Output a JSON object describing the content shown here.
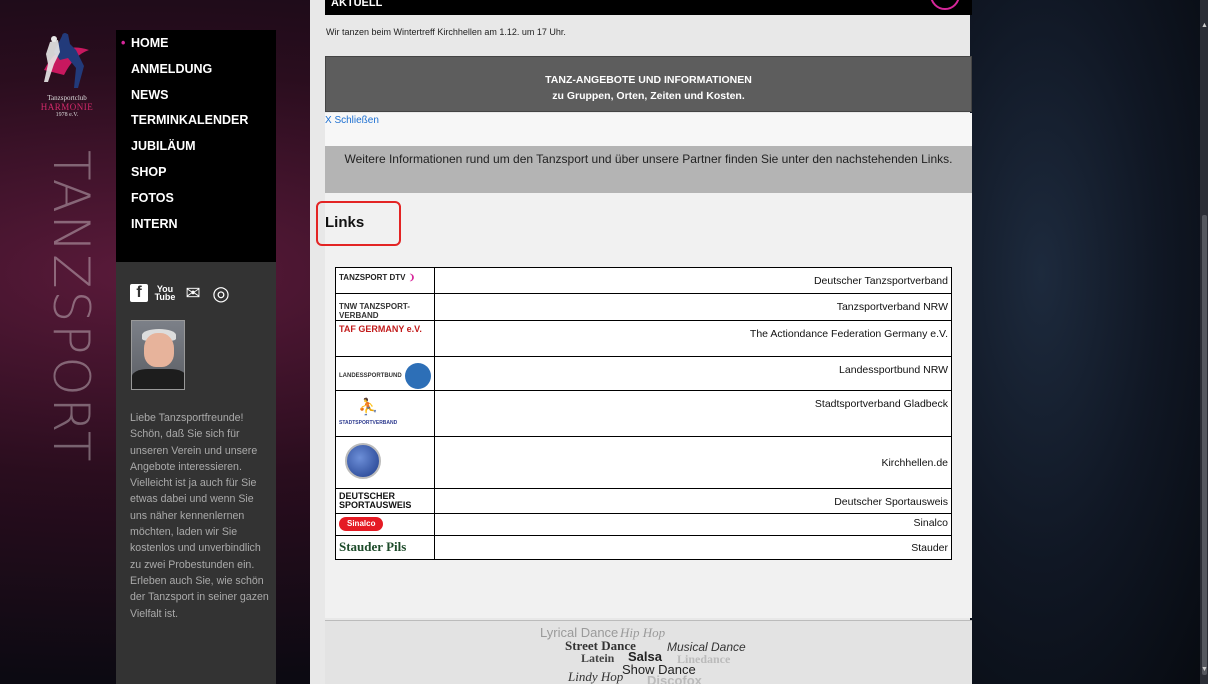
{
  "brand": {
    "logo_small": "Tanzsportclub",
    "logo_club": "HARMONIE",
    "logo_year": "1978 e.V.",
    "vertical_word": "TANZSPORT"
  },
  "nav": {
    "items": [
      {
        "label": "HOME",
        "active": true
      },
      {
        "label": "ANMELDUNG"
      },
      {
        "label": "NEWS"
      },
      {
        "label": "TERMINKALENDER"
      },
      {
        "label": "JUBILÄUM"
      },
      {
        "label": "SHOP"
      },
      {
        "label": "FOTOS"
      },
      {
        "label": "INTERN"
      }
    ]
  },
  "social": {
    "facebook": "f",
    "youtube_top": "You",
    "youtube_bottom": "Tube",
    "mail": "✉",
    "instagram": "◎"
  },
  "sidebar": {
    "welcome_text": "Liebe Tanzsportfreunde! Schön, daß Sie sich für unseren Verein und unsere Angebote interessieren. Vielleicht ist ja auch für Sie etwas dabei und wenn Sie uns näher kennenlernen möchten, laden wir Sie kostenlos und unverbindlich zu zwei Probestunden ein. Erleben auch Sie, wie schön der Tanzsport in seiner gazen Vielfalt ist."
  },
  "main": {
    "aktuell_label": "AKTUELL",
    "news_line": "Wir tanzen beim Wintertreff Kirchhellen am 1.12. um 17 Uhr.",
    "offers_title_1": "TANZ-ANGEBOTE UND INFORMATIONEN",
    "offers_title_2": "zu Gruppen, Orten, Zeiten und Kosten.",
    "close_link": "X Schließen",
    "info_text": "Weitere Informationen rund um den Tanzsport und über unsere Partner finden Sie unter den nachstehenden Links.",
    "links_title": "Links",
    "links": [
      {
        "name": "Deutscher Tanzsportverband",
        "logo": "TANZSPORT DTV"
      },
      {
        "name": "Tanzsportverband NRW",
        "logo": "TNW TANZSPORT-VERBAND"
      },
      {
        "name": "The Actiondance Federation Germany e.V.",
        "logo": "TAF GERMANY e.V."
      },
      {
        "name": "Landessportbund NRW",
        "logo": "LANDESSPORTBUND"
      },
      {
        "name": "Stadtsportverband Gladbeck",
        "logo": "STADTSPORTVERBAND"
      },
      {
        "name": "Kirchhellen.de",
        "logo": ""
      },
      {
        "name": "Deutscher Sportausweis",
        "logo": "DEUTSCHER SPORTAUSWEIS"
      },
      {
        "name": "Sinalco",
        "logo": "Sinalco"
      },
      {
        "name": "Stauder",
        "logo": "Stauder Pils"
      }
    ],
    "dance_cloud": [
      {
        "word": "Lyrical Dance",
        "style": "c1"
      },
      {
        "word": "Hip Hop",
        "style": "c2"
      },
      {
        "word": "Street Dance",
        "style": "c3"
      },
      {
        "word": "Musical Dance",
        "style": "c4"
      },
      {
        "word": "Latein",
        "style": "c5"
      },
      {
        "word": "Salsa",
        "style": "c6"
      },
      {
        "word": "Linedance",
        "style": "c7"
      },
      {
        "word": "Show Dance",
        "style": "c8"
      },
      {
        "word": "Lindy Hop",
        "style": "c9"
      },
      {
        "word": "Discofox",
        "style": "c10"
      }
    ]
  }
}
